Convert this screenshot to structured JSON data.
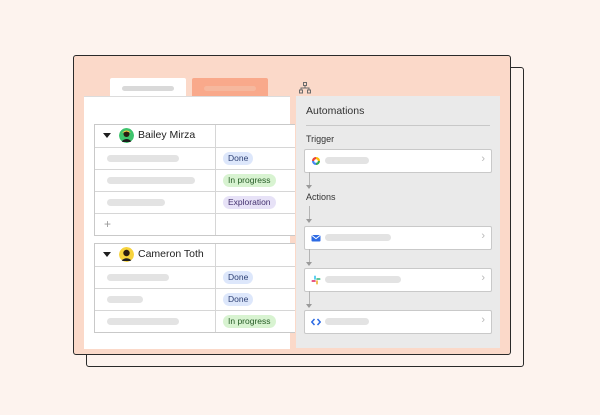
{
  "tabs": [
    {
      "label": "",
      "state": "active"
    },
    {
      "label": "",
      "state": "inactive"
    }
  ],
  "colors": {
    "page_bg": "#fdf3ee",
    "window_bg": "#fbd9c9",
    "active_tab": "#ffffff",
    "inactive_tab": "#f9a98b",
    "panel_bg": "#eaeaea",
    "badge_done": "#dde7fb",
    "badge_in_progress": "#d8f3d1",
    "badge_exploration": "#e7e2f7"
  },
  "groups": [
    {
      "name": "Bailey Mirza",
      "expanded": true,
      "rows": [
        {
          "status": "Done"
        },
        {
          "status": "In progress"
        },
        {
          "status": "Exploration"
        }
      ],
      "add_label": "+"
    },
    {
      "name": "Cameron Toth",
      "expanded": true,
      "rows": [
        {
          "status": "Done"
        },
        {
          "status": "Done"
        },
        {
          "status": "In progress"
        }
      ]
    }
  ],
  "automations": {
    "title": "Automations",
    "trigger_label": "Trigger",
    "actions_label": "Actions",
    "trigger": {
      "icon": "google-calendar-icon"
    },
    "actions": [
      {
        "icon": "email-icon"
      },
      {
        "icon": "slack-icon"
      },
      {
        "icon": "code-icon"
      }
    ]
  }
}
